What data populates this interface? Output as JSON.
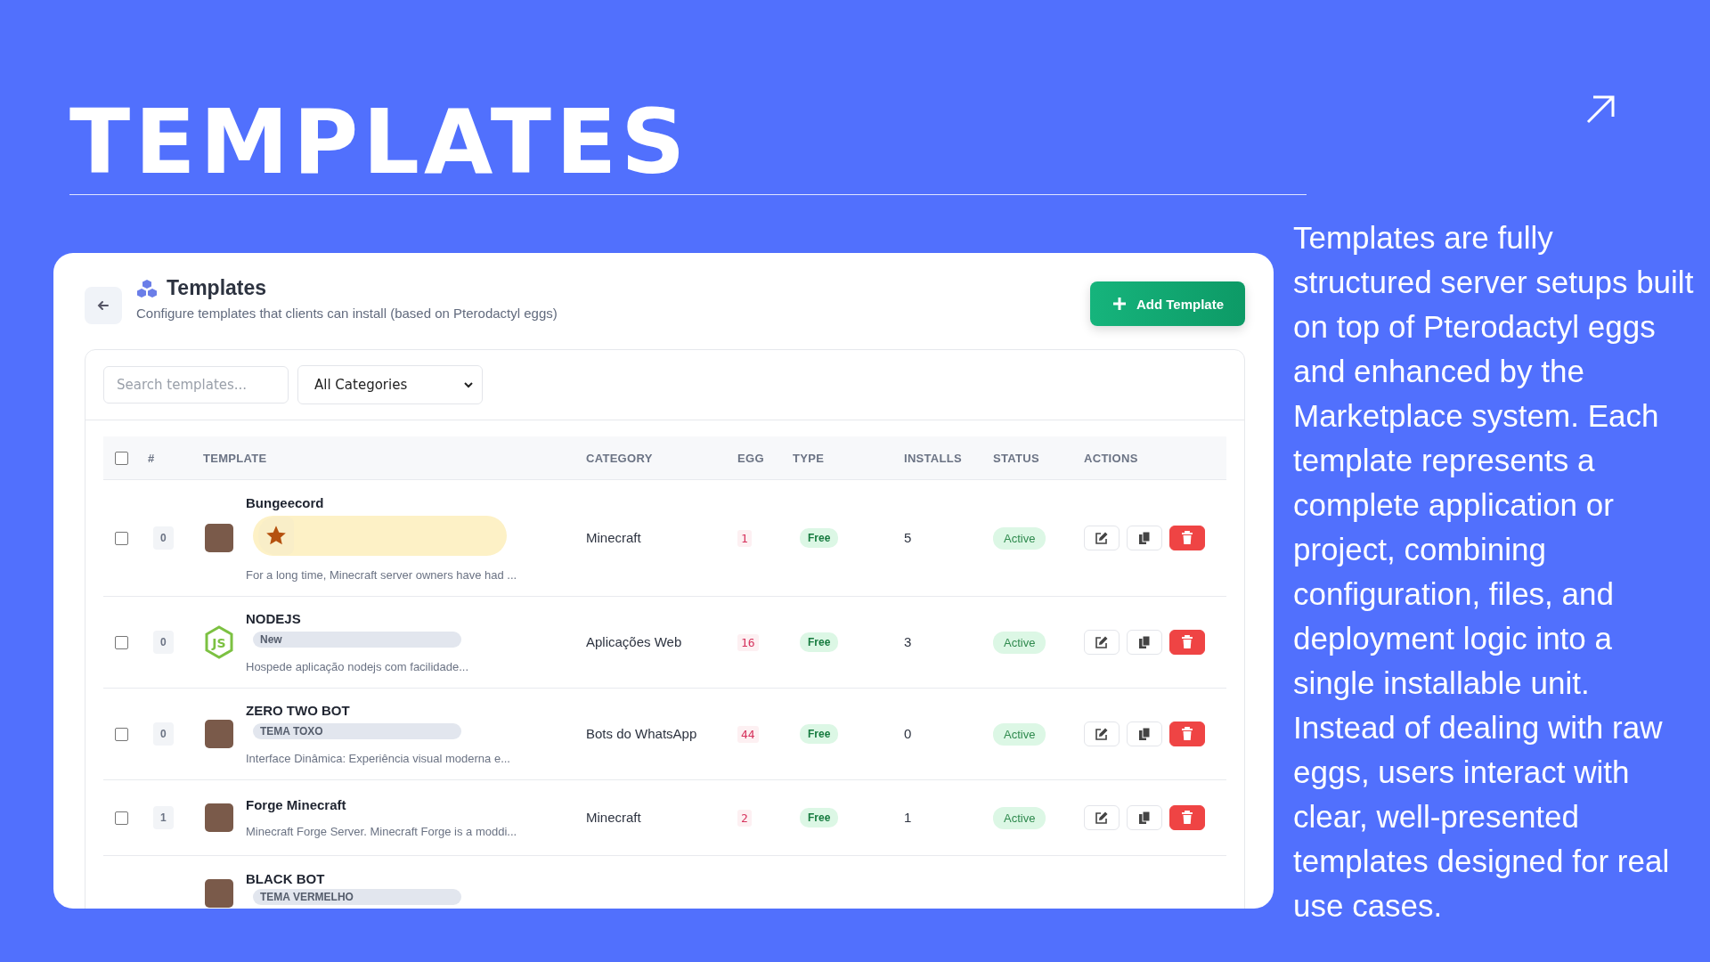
{
  "slide": {
    "title": "TEMPLATES",
    "description": "Templates are fully structured server setups built on top of Pterodactyl eggs and enhanced by the Marketplace system. Each template represents a complete application or project, combining configuration, files, and deployment logic into a single installable unit. Instead of dealing with raw eggs, users interact with clear, well-presented templates designed for real use cases."
  },
  "header": {
    "title": "Templates",
    "subtitle": "Configure templates that clients can install (based on Pterodactyl eggs)",
    "add_button": "Add Template"
  },
  "filters": {
    "search": {
      "placeholder": "Search templates..."
    },
    "category": {
      "value": "All Categories"
    }
  },
  "table": {
    "select_all": {
      "checked": false
    },
    "columns": [
      "#",
      "TEMPLATE",
      "CATEGORY",
      "EGG",
      "TYPE",
      "INSTALLS",
      "STATUS",
      "ACTIONS"
    ],
    "rows": [
      {
        "checked": false,
        "index": "0",
        "thumb": {
          "kind": "image"
        },
        "name": "Bungeecord",
        "badge": {
          "kind": "star"
        },
        "description": "For a long time, Minecraft server owners have had ...",
        "category": "Minecraft",
        "egg": "1",
        "type": "Free",
        "installs": "5",
        "status": "Active"
      },
      {
        "checked": false,
        "index": "0",
        "thumb": {
          "kind": "logo",
          "text": "JS"
        },
        "name": "NODEJS",
        "badge": {
          "kind": "label",
          "text": "New"
        },
        "description": "Hospede aplicação nodejs com facilidade...",
        "category": "Aplicações Web",
        "egg": "16",
        "type": "Free",
        "installs": "3",
        "status": "Active"
      },
      {
        "checked": false,
        "index": "0",
        "thumb": {
          "kind": "image"
        },
        "name": "ZERO TWO BOT",
        "badge": {
          "kind": "label",
          "text": "TEMA TOXO"
        },
        "description": "Interface Dinâmica: Experiência visual moderna e...",
        "category": "Bots do WhatsApp",
        "egg": "44",
        "type": "Free",
        "installs": "0",
        "status": "Active"
      },
      {
        "checked": false,
        "index": "1",
        "thumb": {
          "kind": "image"
        },
        "name": "Forge Minecraft",
        "description": "Minecraft Forge Server. Minecraft Forge is a moddi...",
        "category": "Minecraft",
        "egg": "2",
        "type": "Free",
        "installs": "1",
        "status": "Active"
      },
      {
        "thumb": {
          "kind": "image"
        },
        "name": "BLACK BOT",
        "badge": {
          "kind": "label",
          "text": "TEMA VERMELHO"
        }
      }
    ]
  }
}
